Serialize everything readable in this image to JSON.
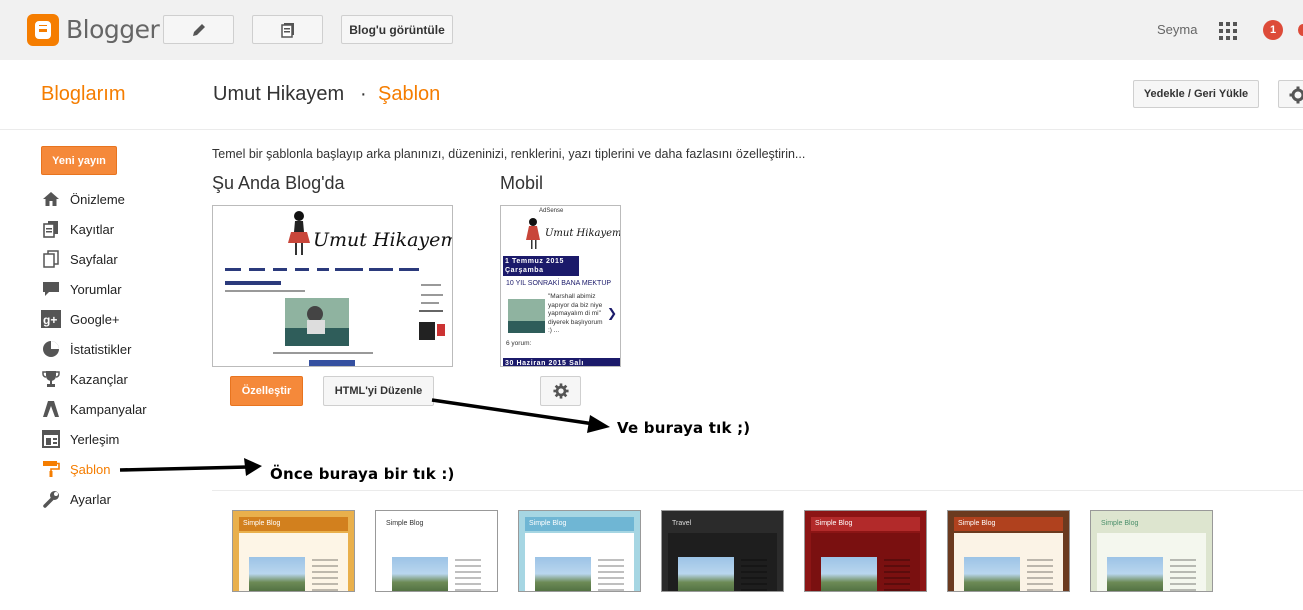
{
  "topbar": {
    "logo_text": "Blogger",
    "view_blog_label": "Blog'u görüntüle",
    "user_name": "Seyma",
    "notification_count": "1"
  },
  "header": {
    "my_blogs": "Bloglarım",
    "blog_title": "Umut Hikayem",
    "separator": "·",
    "page_title": "Şablon",
    "backup_label": "Yedekle / Geri Yükle"
  },
  "sidebar": {
    "new_post_label": "Yeni yayın",
    "items": [
      {
        "label": "Önizleme",
        "icon": "home-icon"
      },
      {
        "label": "Kayıtlar",
        "icon": "posts-icon"
      },
      {
        "label": "Sayfalar",
        "icon": "pages-icon"
      },
      {
        "label": "Yorumlar",
        "icon": "comments-icon"
      },
      {
        "label": "Google+",
        "icon": "google-plus-icon"
      },
      {
        "label": "İstatistikler",
        "icon": "stats-icon"
      },
      {
        "label": "Kazançlar",
        "icon": "trophy-icon"
      },
      {
        "label": "Kampanyalar",
        "icon": "campaign-icon"
      },
      {
        "label": "Yerleşim",
        "icon": "layout-icon"
      },
      {
        "label": "Şablon",
        "icon": "template-icon",
        "active": true
      },
      {
        "label": "Ayarlar",
        "icon": "wrench-icon"
      }
    ]
  },
  "main": {
    "intro": "Temel bir şablonla başlayıp arka planınızı, düzeninizi, renklerini, yazı tiplerini ve daha fazlasını özelleştirin...",
    "current_title": "Şu Anda Blog'da",
    "mobile_title": "Mobil",
    "customize_label": "Özelleştir",
    "edit_html_label": "HTML'yi Düzenle",
    "preview_blog_title": "Umut Hikayem",
    "mobile_preview": {
      "adsense": "AdSense",
      "date1": "1 Temmuz 2015 Çarşamba",
      "post_title": "10 YIL SONRAKİ BANA MEKTUP",
      "excerpt": "\"Marshall abimiz yapıyor da biz niye yapmayalım di mi\" diyerek başlıyorum :) ...",
      "comments": "6 yorum:",
      "date2": "30 Haziran 2015 Salı"
    }
  },
  "annotations": {
    "first": "Önce buraya bir tık :)",
    "second": "Ve buraya tık ;)"
  },
  "templates": [
    {
      "title": "Simple Blog",
      "bg": "#e9b04c",
      "head": "#d2801e",
      "text": "#ffffff",
      "body": "#fdf5e6"
    },
    {
      "title": "Simple Blog",
      "bg": "#ffffff",
      "head": "#ffffff",
      "text": "#333333",
      "body": "#ffffff"
    },
    {
      "title": "Simple Blog",
      "bg": "#a6d6e3",
      "head": "#6fb6d4",
      "text": "#ffffff",
      "body": "#ffffff"
    },
    {
      "title": "Travel",
      "bg": "#2b2b2b",
      "head": "#2b2b2b",
      "text": "#dddddd",
      "body": "#1e1e1e"
    },
    {
      "title": "Simple Blog",
      "bg": "#8c1515",
      "head": "#b22a2a",
      "text": "#ffffff",
      "body": "#7a1010"
    },
    {
      "title": "Simple Blog",
      "bg": "#6b3a1f",
      "head": "#b0411e",
      "text": "#ffffff",
      "body": "#fbf3e6"
    },
    {
      "title": "Simple Blog",
      "bg": "#dde5cf",
      "head": "#dde5cf",
      "text": "#4a8f6a",
      "body": "#f4f7ee"
    }
  ]
}
